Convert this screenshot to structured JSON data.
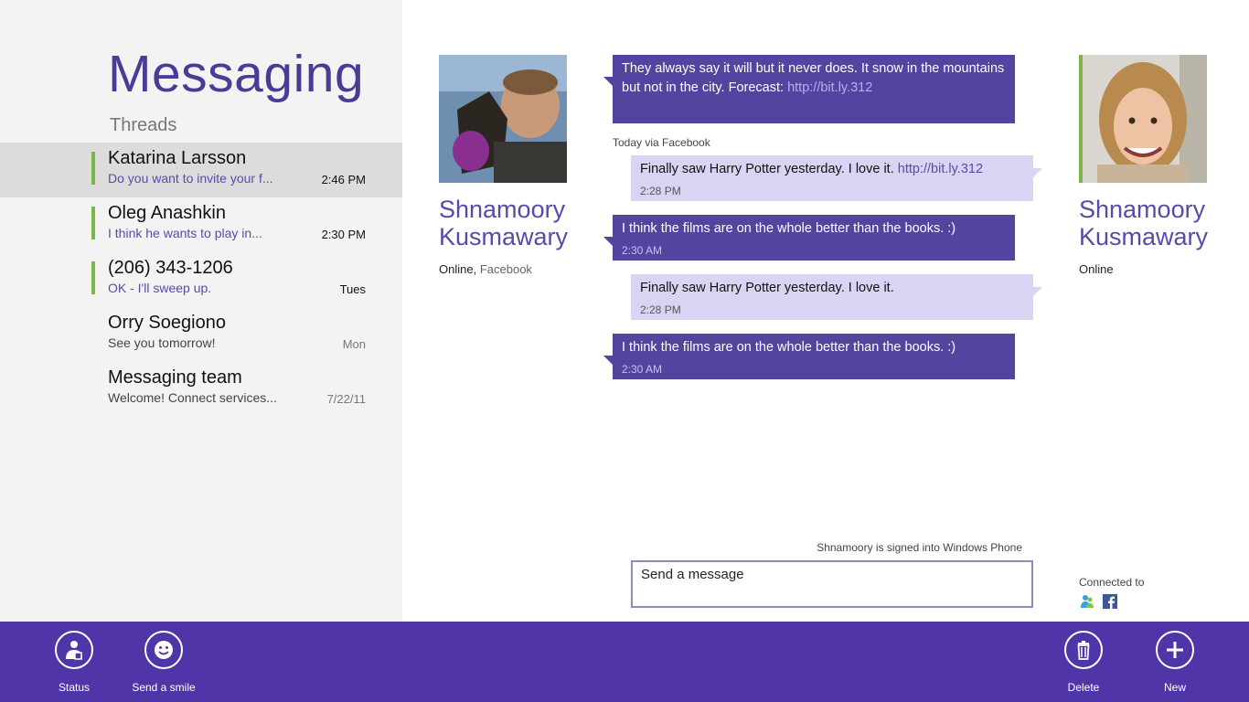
{
  "app": {
    "title": "Messaging",
    "section": "Threads"
  },
  "threads": [
    {
      "name": "Katarina Larsson",
      "preview": "Do you want to invite your f...",
      "time": "2:46 PM",
      "unread": true,
      "selected": true
    },
    {
      "name": "Oleg Anashkin",
      "preview": "I think he wants to play in...",
      "time": "2:30 PM",
      "unread": true,
      "selected": false
    },
    {
      "name": "(206) 343-1206",
      "preview": "OK - I'll sweep up.",
      "time": "Tues",
      "unread": true,
      "selected": false
    },
    {
      "name": "Orry Soegiono",
      "preview": "See you tomorrow!",
      "time": "Mon",
      "unread": false,
      "selected": false
    },
    {
      "name": "Messaging team",
      "preview": "Welcome! Connect services...",
      "time": "7/22/11",
      "unread": false,
      "selected": false
    }
  ],
  "contact_left": {
    "first": "Shnamoory",
    "last": "Kusmawary",
    "status": "Online,",
    "service": "Facebook"
  },
  "contact_right": {
    "first": "Shnamoory",
    "last": "Kusmawary",
    "status": "Online"
  },
  "conversation": {
    "day_label": "Today via Facebook",
    "messages": [
      {
        "dir": "in",
        "text": "They always say it will but it never does.  It snow in the mountains but not in the city. Forecast:",
        "link": "http://bit.ly.312",
        "time": ""
      },
      {
        "dir": "out",
        "text": "Finally saw Harry Potter yesterday. I love it.",
        "link": "http://bit.ly.312",
        "time": "2:28 PM"
      },
      {
        "dir": "in",
        "text": "I think the films are on the whole better than the books. :)",
        "link": "",
        "time": "2:30 AM"
      },
      {
        "dir": "out",
        "text": "Finally saw Harry Potter yesterday. I love it.",
        "link": "",
        "time": "2:28 PM"
      },
      {
        "dir": "in",
        "text": "I think the films are on the whole better than the books. :)",
        "link": "",
        "time": "2:30 AM"
      }
    ]
  },
  "compose": {
    "signed_in_note": "Shnamoory is signed into Windows Phone",
    "placeholder": "Send a message"
  },
  "connected": {
    "label": "Connected to",
    "services": [
      "messenger-icon",
      "facebook-icon"
    ]
  },
  "app_bar": {
    "status_label": "Status",
    "smile_label": "Send a smile",
    "delete_label": "Delete",
    "new_label": "New"
  },
  "colors": {
    "accent": "#4f35a8",
    "bubble_in": "#53449f",
    "bubble_out": "#d9d4f3",
    "presence": "#7ab648",
    "title": "#4a3b96"
  }
}
